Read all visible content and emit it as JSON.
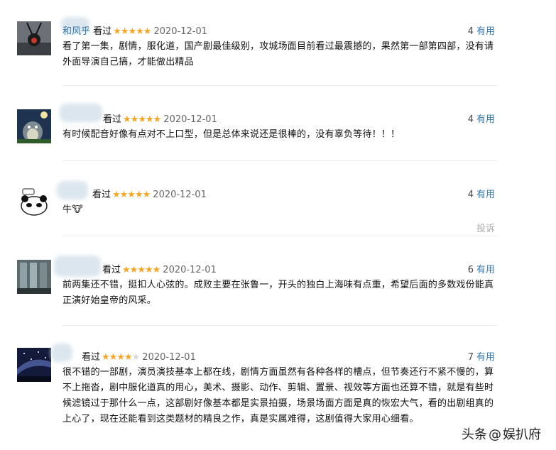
{
  "comments": [
    {
      "username": "和风乎",
      "status": "看过",
      "stars": "★★★★★",
      "stars_off": "",
      "date": "2020-12-01",
      "votes": "4",
      "useful_label": "有用",
      "text": "看了第一集，剧情，服化道，国产剧最佳级别，攻城场面目前看过最震撼的，果然第一部第四部，没有请外面导演自己搞，才能做出精品"
    },
    {
      "username": "",
      "status": "看过",
      "stars": "★★★★★",
      "stars_off": "",
      "date": "2020-12-01",
      "votes": "4",
      "useful_label": "有用",
      "text": "有时候配音好像有点对不上口型，但是总体来说还是很棒的，没有辜负等待！！！"
    },
    {
      "username": "",
      "status": "看过",
      "stars": "★★★★★",
      "stars_off": "",
      "date": "2020-12-01",
      "votes": "4",
      "useful_label": "有用",
      "text": "牛🐮",
      "report_label": "投诉"
    },
    {
      "username": "",
      "status": "看过",
      "stars": "★★★★★",
      "stars_off": "",
      "date": "2020-12-01",
      "votes": "6",
      "useful_label": "有用",
      "text": "前两集还不错，挺扣人心弦的。成败主要在张鲁一，开头的独白上海味有点重，希望后面的多数戏份能真正演好始皇帝的风采。"
    },
    {
      "username": "",
      "status": "看过",
      "stars": "★★★★",
      "stars_off": "★",
      "date": "2020-12-01",
      "votes": "7",
      "useful_label": "有用",
      "text": "很不错的一部剧，演员演技基本上都在线，剧情方面虽然有各种各样的槽点，但节奏还行不紧不慢的，算不上拖沓，剧中服化道真的用心，美术、摄影、动作、剪辑、置景、视效等方面也还算不错，就是有些时候滤镜过于那什么一点，这部剧好像基本都是实景拍摄，场景场面方面是真的恢宏大气，看的出剧组真的上心了，现在还能看到这类题材的精良之作，真是实属难得，这剧值得大家用心细看。"
    }
  ],
  "watermark": {
    "platform": "头条",
    "at": "@",
    "account": "娱扒府"
  }
}
